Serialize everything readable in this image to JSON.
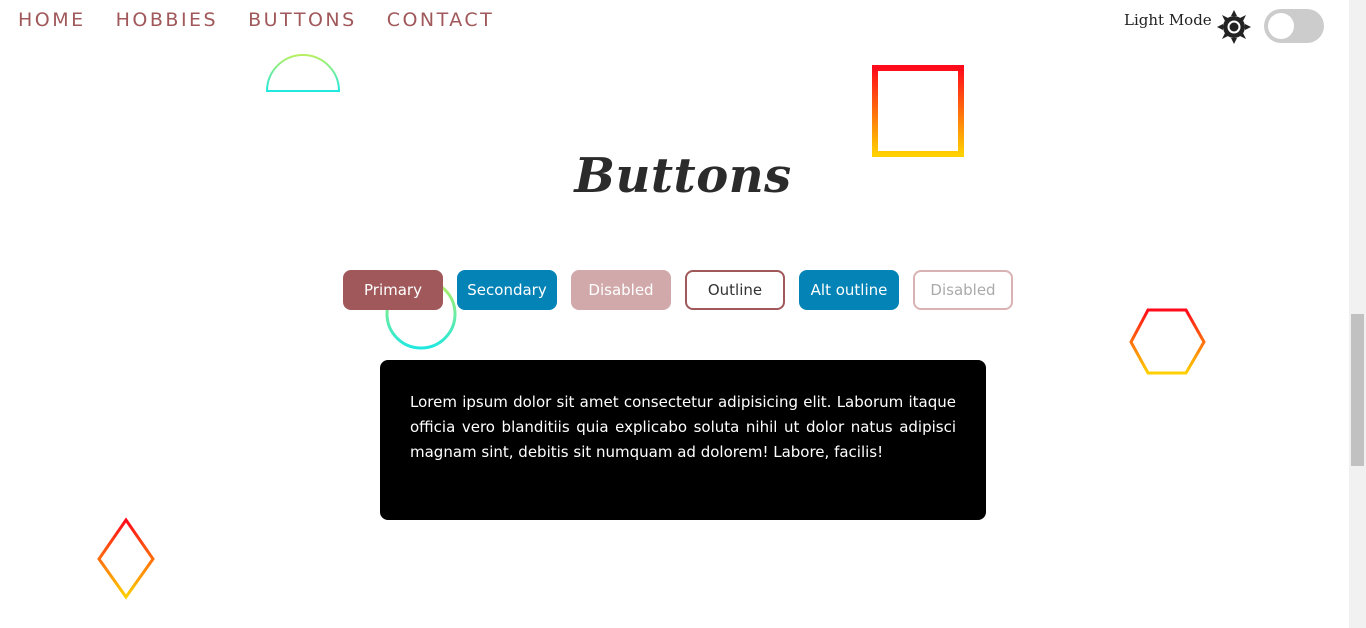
{
  "nav": {
    "items": [
      "HOME",
      "HOBBIES",
      "BUTTONS",
      "CONTACT"
    ]
  },
  "mode": {
    "label": "Light Mode",
    "icon": "sun-icon",
    "toggle_on": false
  },
  "page": {
    "title": "Buttons"
  },
  "buttons": {
    "primary": "Primary",
    "secondary": "Secondary",
    "disabled": "Disabled",
    "outline": "Outline",
    "alt_outline": "Alt outline",
    "disabled_outline": "Disabled"
  },
  "card": {
    "text": "Lorem ipsum dolor sit amet consectetur adipisicing elit. Laborum itaque officia vero blanditiis quia explicabo soluta nihil ut dolor natus adipisci magnam sint, debitis sit numquam ad dolorem! Labore, facilis!"
  },
  "colors": {
    "accent": "#a0585a",
    "secondary": "#0383b6",
    "card_bg": "#000000"
  }
}
